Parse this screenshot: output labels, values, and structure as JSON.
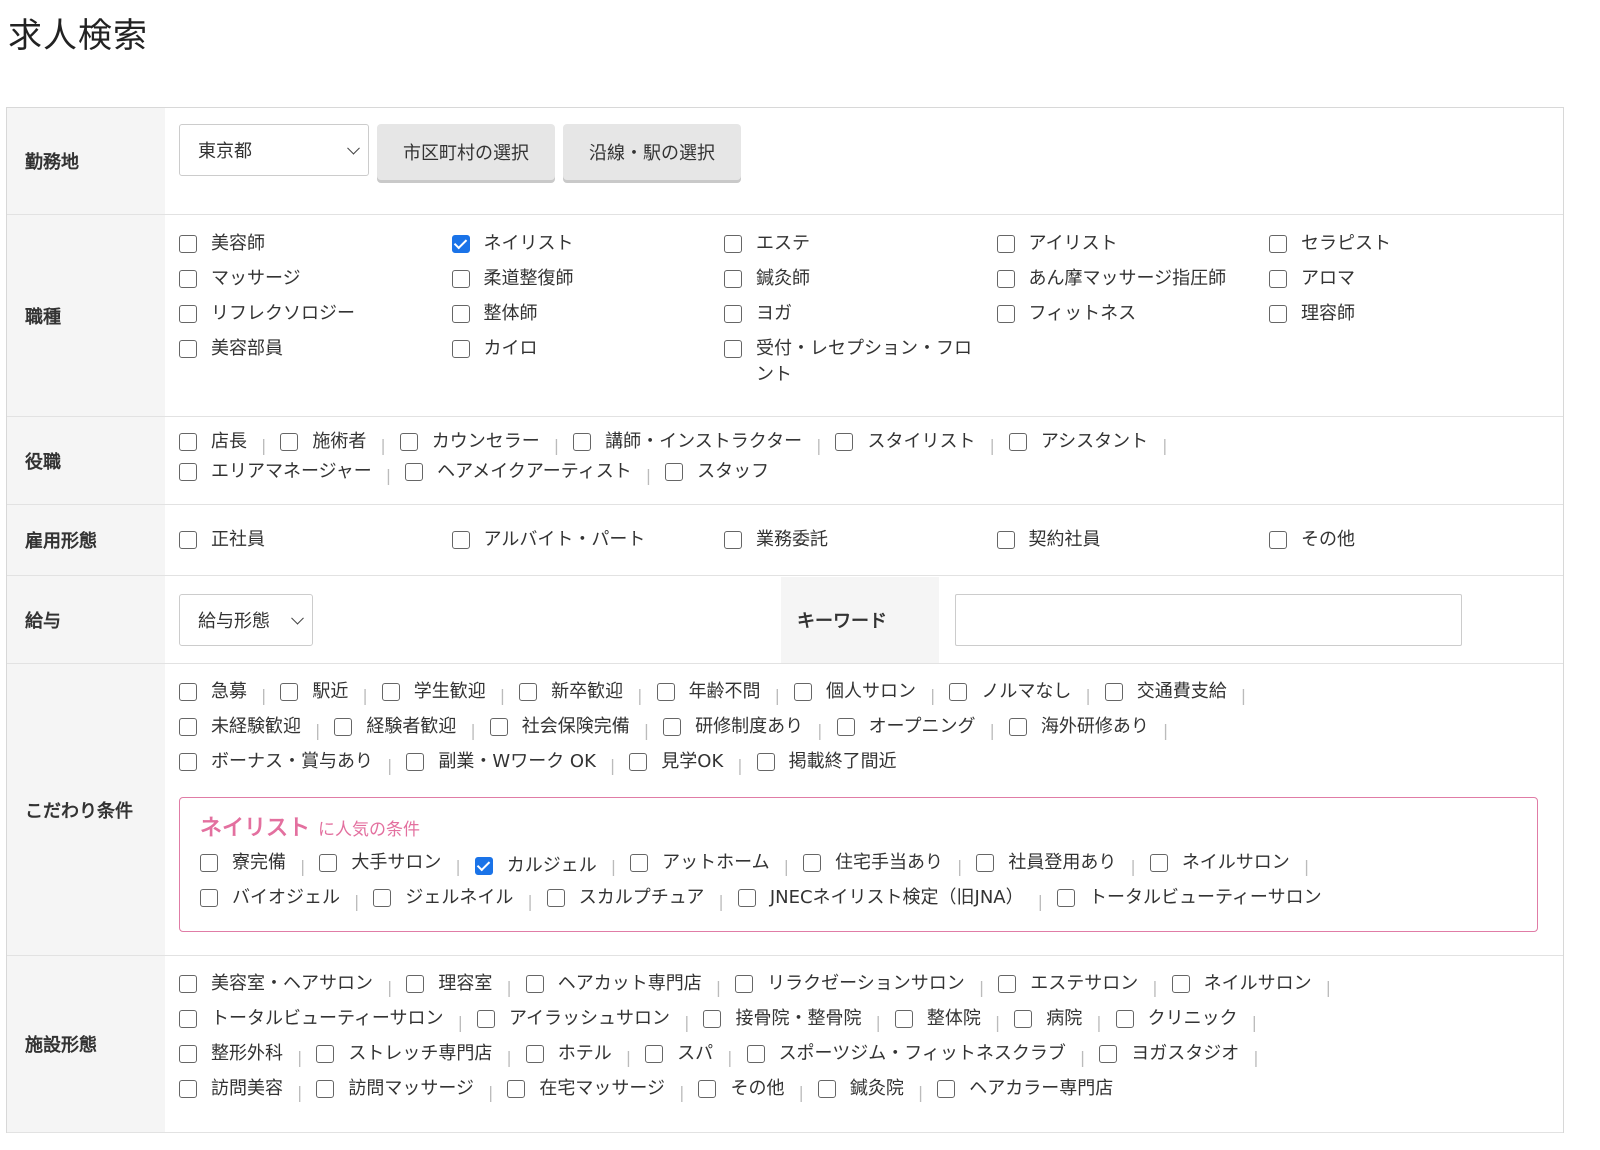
{
  "page_title": "求人検索",
  "location": {
    "label": "勤務地",
    "prefecture": "東京都",
    "city_button": "市区町村の選択",
    "line_button": "沿線・駅の選択"
  },
  "job_type": {
    "label": "職種",
    "items": [
      {
        "label": "美容師",
        "checked": false
      },
      {
        "label": "ネイリスト",
        "checked": true
      },
      {
        "label": "エステ",
        "checked": false
      },
      {
        "label": "アイリスト",
        "checked": false
      },
      {
        "label": "セラピスト",
        "checked": false
      },
      {
        "label": "マッサージ",
        "checked": false
      },
      {
        "label": "柔道整復師",
        "checked": false
      },
      {
        "label": "鍼灸師",
        "checked": false
      },
      {
        "label": "あん摩マッサージ指圧師",
        "checked": false
      },
      {
        "label": "アロマ",
        "checked": false
      },
      {
        "label": "リフレクソロジー",
        "checked": false
      },
      {
        "label": "整体師",
        "checked": false
      },
      {
        "label": "ヨガ",
        "checked": false
      },
      {
        "label": "フィットネス",
        "checked": false
      },
      {
        "label": "理容師",
        "checked": false
      },
      {
        "label": "美容部員",
        "checked": false
      },
      {
        "label": "カイロ",
        "checked": false
      },
      {
        "label": "受付・レセプション・フロント",
        "checked": false
      }
    ]
  },
  "position": {
    "label": "役職",
    "items": [
      {
        "label": "店長",
        "checked": false
      },
      {
        "label": "施術者",
        "checked": false
      },
      {
        "label": "カウンセラー",
        "checked": false
      },
      {
        "label": "講師・インストラクター",
        "checked": false
      },
      {
        "label": "スタイリスト",
        "checked": false
      },
      {
        "label": "アシスタント",
        "checked": false
      },
      {
        "label": "エリアマネージャー",
        "checked": false
      },
      {
        "label": "ヘアメイクアーティスト",
        "checked": false
      },
      {
        "label": "スタッフ",
        "checked": false
      }
    ]
  },
  "employment": {
    "label": "雇用形態",
    "items": [
      {
        "label": "正社員",
        "checked": false
      },
      {
        "label": "アルバイト・パート",
        "checked": false
      },
      {
        "label": "業務委託",
        "checked": false
      },
      {
        "label": "契約社員",
        "checked": false
      },
      {
        "label": "その他",
        "checked": false
      }
    ]
  },
  "salary": {
    "label": "給与",
    "select": "給与形態",
    "keyword_label": "キーワード",
    "keyword_value": ""
  },
  "preferences": {
    "label": "こだわり条件",
    "items": [
      {
        "label": "急募",
        "checked": false
      },
      {
        "label": "駅近",
        "checked": false
      },
      {
        "label": "学生歓迎",
        "checked": false
      },
      {
        "label": "新卒歓迎",
        "checked": false
      },
      {
        "label": "年齢不問",
        "checked": false
      },
      {
        "label": "個人サロン",
        "checked": false
      },
      {
        "label": "ノルマなし",
        "checked": false
      },
      {
        "label": "交通費支給",
        "checked": false
      },
      {
        "label": "未経験歓迎",
        "checked": false
      },
      {
        "label": "経験者歓迎",
        "checked": false
      },
      {
        "label": "社会保険完備",
        "checked": false
      },
      {
        "label": "研修制度あり",
        "checked": false
      },
      {
        "label": "オープニング",
        "checked": false
      },
      {
        "label": "海外研修あり",
        "checked": false
      },
      {
        "label": "ボーナス・賞与あり",
        "checked": false
      },
      {
        "label": "副業・Wワーク OK",
        "checked": false
      },
      {
        "label": "見学OK",
        "checked": false
      },
      {
        "label": "掲載終了間近",
        "checked": false
      }
    ],
    "popular": {
      "title": "ネイリスト",
      "subtitle": "に人気の条件",
      "items": [
        {
          "label": "寮完備",
          "checked": false
        },
        {
          "label": "大手サロン",
          "checked": false
        },
        {
          "label": "カルジェル",
          "checked": true
        },
        {
          "label": "アットホーム",
          "checked": false
        },
        {
          "label": "住宅手当あり",
          "checked": false
        },
        {
          "label": "社員登用あり",
          "checked": false
        },
        {
          "label": "ネイルサロン",
          "checked": false
        },
        {
          "label": "バイオジェル",
          "checked": false
        },
        {
          "label": "ジェルネイル",
          "checked": false
        },
        {
          "label": "スカルプチュア",
          "checked": false
        },
        {
          "label": "JNECネイリスト検定（旧JNA）",
          "checked": false
        },
        {
          "label": "トータルビューティーサロン",
          "checked": false
        }
      ]
    }
  },
  "facility": {
    "label": "施設形態",
    "items": [
      {
        "label": "美容室・ヘアサロン",
        "checked": false
      },
      {
        "label": "理容室",
        "checked": false
      },
      {
        "label": "ヘアカット専門店",
        "checked": false
      },
      {
        "label": "リラクゼーションサロン",
        "checked": false
      },
      {
        "label": "エステサロン",
        "checked": false
      },
      {
        "label": "ネイルサロン",
        "checked": false
      },
      {
        "label": "トータルビューティーサロン",
        "checked": false
      },
      {
        "label": "アイラッシュサロン",
        "checked": false
      },
      {
        "label": "接骨院・整骨院",
        "checked": false
      },
      {
        "label": "整体院",
        "checked": false
      },
      {
        "label": "病院",
        "checked": false
      },
      {
        "label": "クリニック",
        "checked": false
      },
      {
        "label": "整形外科",
        "checked": false
      },
      {
        "label": "ストレッチ専門店",
        "checked": false
      },
      {
        "label": "ホテル",
        "checked": false
      },
      {
        "label": "スパ",
        "checked": false
      },
      {
        "label": "スポーツジム・フィットネスクラブ",
        "checked": false
      },
      {
        "label": "ヨガスタジオ",
        "checked": false
      },
      {
        "label": "訪問美容",
        "checked": false
      },
      {
        "label": "訪問マッサージ",
        "checked": false
      },
      {
        "label": "在宅マッサージ",
        "checked": false
      },
      {
        "label": "その他",
        "checked": false
      },
      {
        "label": "鍼灸院",
        "checked": false
      },
      {
        "label": "ヘアカラー専門店",
        "checked": false
      }
    ]
  }
}
